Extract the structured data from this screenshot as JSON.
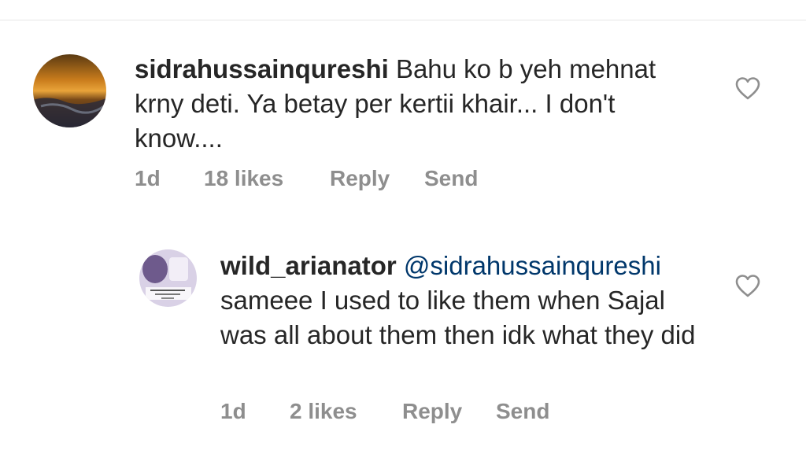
{
  "comments": [
    {
      "username": "sidrahussainqureshi",
      "text": "Bahu ko b yeh mehnat krny deti. Ya betay per kertii khair... I don't know....",
      "time": "1d",
      "likes": "18 likes",
      "reply_label": "Reply",
      "send_label": "Send"
    },
    {
      "username": "wild_arianator",
      "mention": "@sidrahussainqureshi",
      "text": "sameee I used to like them when Sajal was all about them then idk what they did",
      "time": "1d",
      "likes": "2 likes",
      "reply_label": "Reply",
      "send_label": "Send"
    }
  ],
  "icons": {
    "like": "heart-outline-icon"
  },
  "colors": {
    "text": "#262626",
    "meta": "#8e8e8e",
    "mention": "#00376b",
    "divider": "#e6e6e6"
  }
}
